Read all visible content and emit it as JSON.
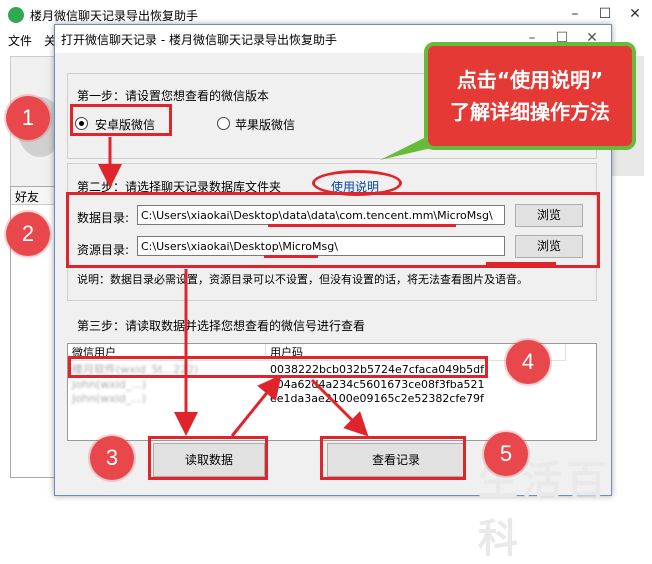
{
  "window": {
    "title": "楼月微信聊天记录导出恢复助手",
    "menu": [
      "文件",
      "关"
    ],
    "left_list_header": "好友"
  },
  "dialog": {
    "title": "打开微信聊天记录 - 楼月微信聊天记录导出恢复助手",
    "step1": {
      "label": "第一步：请设置您想查看的微信版本",
      "option_android": "安卓版微信",
      "option_ios": "苹果版微信",
      "selected": "安卓版微信"
    },
    "step2": {
      "label": "第二步：请选择聊天记录数据库文件夹",
      "help_link": "使用说明",
      "data_dir_label": "数据目录:",
      "data_dir_value": "C:\\Users\\xiaokai\\Desktop\\data\\data\\com.tencent.mm\\MicroMsg\\",
      "res_dir_label": "资源目录:",
      "res_dir_value": "C:\\Users\\xiaokai\\Desktop\\MicroMsg\\",
      "browse_label": "浏览",
      "note": "说明：数据目录必需设置，资源目录可以不设置，但没有设置的话，将无法查看图片及语音。"
    },
    "step3": {
      "label": "第三步：请读取数据并选择您想查看的微信号进行查看",
      "columns": [
        "微信用户",
        "用户码"
      ],
      "rows": [
        {
          "user": "楼月软件(wxid_5t...222)",
          "code": "0038222bcb032b5724e7cfaca049b5df"
        },
        {
          "user": "John(wxid_...)",
          "code": "a04a62d4a234c5601673ce08f3fba521"
        },
        {
          "user": "John(wxid_...)",
          "code": "ee1da3ae2100e09165c2e52382cfe79f"
        }
      ]
    },
    "read_button": "读取数据",
    "view_button": "查看记录"
  },
  "annotations": {
    "callout_line1": "点击“使用说明”",
    "callout_line2": "了解详细操作方法",
    "steps": [
      "1",
      "2",
      "3",
      "4",
      "5"
    ],
    "accent_red": "#e0242b",
    "callout_border": "#66bb3a"
  },
  "watermark": "生活百科"
}
